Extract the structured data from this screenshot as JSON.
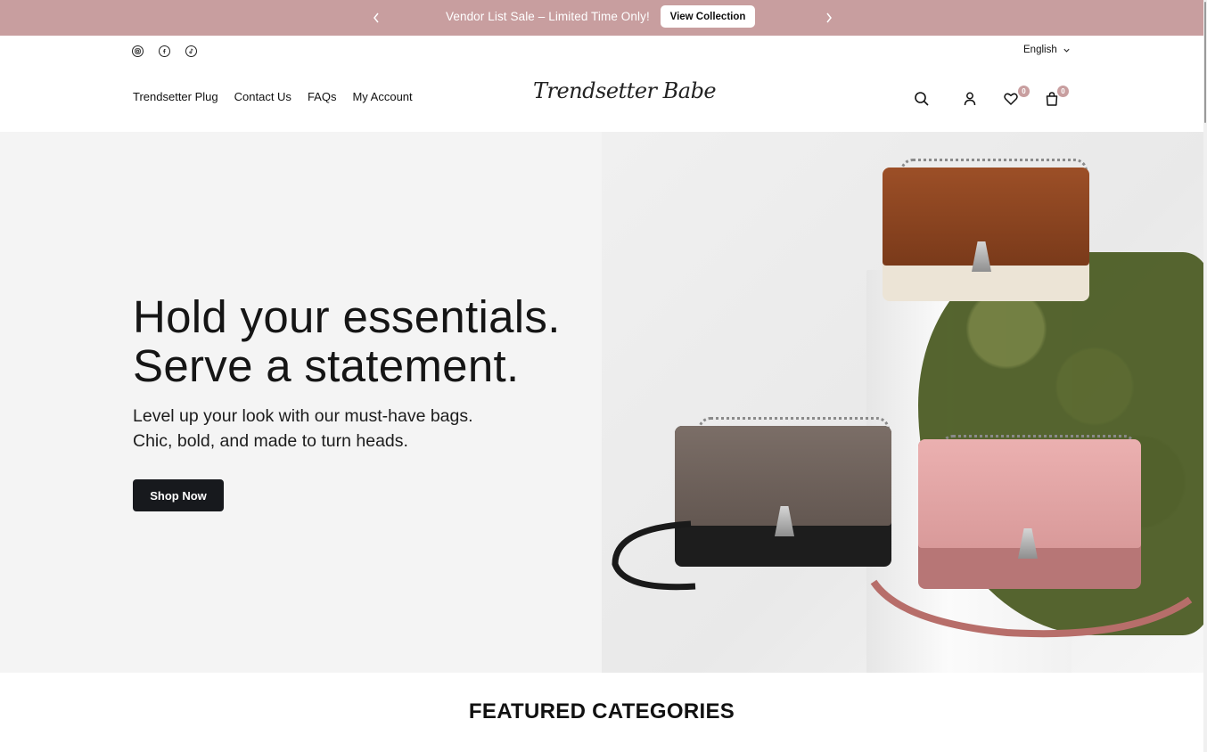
{
  "announcement": {
    "message": "Vendor List Sale – Limited Time Only!",
    "cta_label": "View Collection",
    "background": "#c89e9f"
  },
  "header": {
    "socials": [
      "instagram-icon",
      "facebook-icon",
      "tiktok-icon"
    ],
    "language": "English",
    "nav": [
      {
        "label": "Trendsetter Plug"
      },
      {
        "label": "Contact Us"
      },
      {
        "label": "FAQs"
      },
      {
        "label": "My Account"
      }
    ],
    "logo": "Trendsetter Babe",
    "wishlist_count": "0",
    "cart_count": "0"
  },
  "hero": {
    "headline_line1": "Hold your essentials.",
    "headline_line2": "Serve a statement.",
    "sub_line1": "Level up your look with our must-have bags.",
    "sub_line2": "Chic, bold, and made to turn heads.",
    "button_label": "Shop Now",
    "button_color": "#17191d"
  },
  "featured": {
    "title": "FEATURED CATEGORIES"
  }
}
